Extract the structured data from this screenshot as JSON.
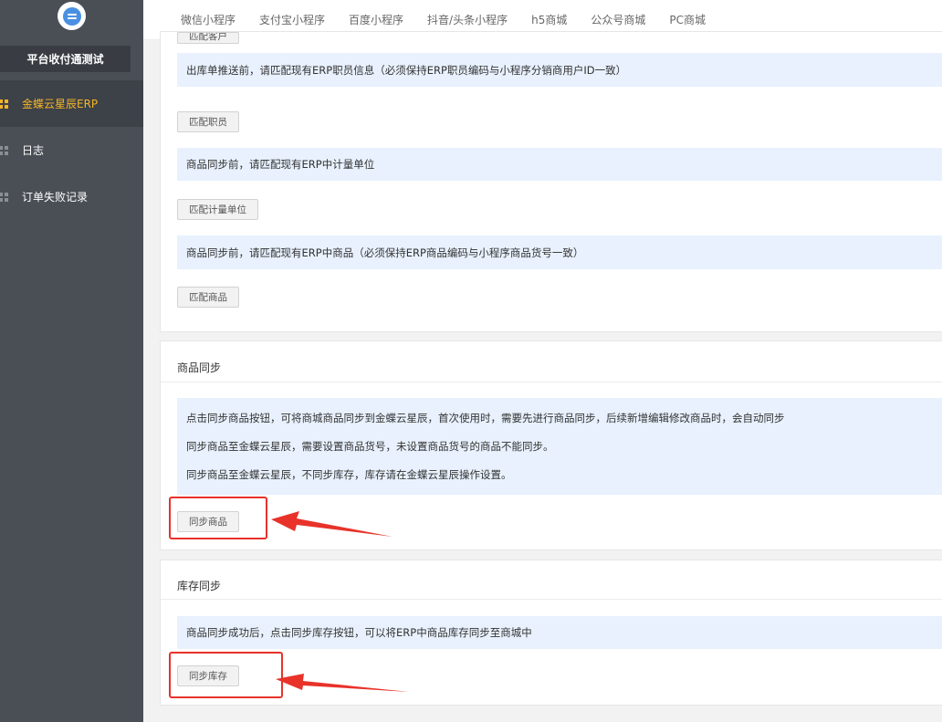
{
  "sidebar": {
    "store_name": "平台收付通测试",
    "items": [
      {
        "label": "金蝶云星辰ERP",
        "active": true
      },
      {
        "label": "日志",
        "active": false
      },
      {
        "label": "订单失败记录",
        "active": false
      }
    ]
  },
  "topnav": {
    "tabs": [
      "微信小程序",
      "支付宝小程序",
      "百度小程序",
      "抖音/头条小程序",
      "h5商城",
      "公众号商城",
      "PC商城"
    ]
  },
  "match_section": {
    "partial_button": "匹配客户",
    "notice_staff": "出库单推送前，请匹配现有ERP职员信息（必须保持ERP职员编码与小程序分销商用户ID一致）",
    "button_staff": "匹配职员",
    "notice_unit": "商品同步前，请匹配现有ERP中计量单位",
    "button_unit": "匹配计量单位",
    "notice_goods": "商品同步前，请匹配现有ERP中商品（必须保持ERP商品编码与小程序商品货号一致）",
    "button_goods": "匹配商品"
  },
  "goods_sync": {
    "title": "商品同步",
    "notes": [
      "点击同步商品按钮，可将商城商品同步到金蝶云星辰，首次使用时，需要先进行商品同步，后续新增编辑修改商品时，会自动同步",
      "同步商品至金蝶云星辰，需要设置商品货号，未设置商品货号的商品不能同步。",
      "同步商品至金蝶云星辰，不同步库存，库存请在金蝶云星辰操作设置。"
    ],
    "button": "同步商品"
  },
  "stock_sync": {
    "title": "库存同步",
    "note": "商品同步成功后，点击同步库存按钮，可以将ERP中商品库存同步至商城中",
    "button": "同步库存"
  },
  "colors": {
    "sidebar_bg": "#4a4f56",
    "active_accent": "#f5b526",
    "notice_bg": "#e8f1fd",
    "annotation_red": "#e8322a"
  }
}
